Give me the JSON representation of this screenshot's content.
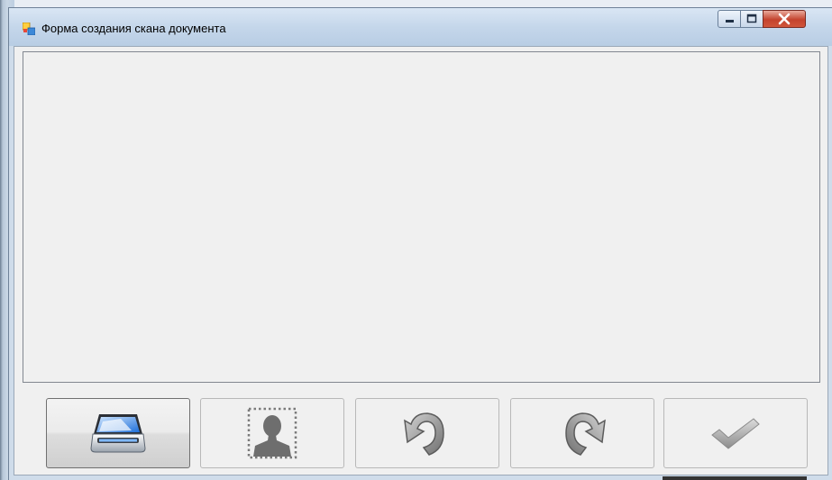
{
  "window": {
    "title": "Форма создания скана документа",
    "controls": [
      "minimize-icon",
      "maximize-icon",
      "close-icon"
    ]
  },
  "toolbar": {
    "buttons": [
      {
        "name": "scan-button",
        "icon": "scanner-icon",
        "active": true
      },
      {
        "name": "select-area-button",
        "icon": "person-selection-icon",
        "active": false
      },
      {
        "name": "rotate-left-button",
        "icon": "rotate-left-icon",
        "active": false
      },
      {
        "name": "rotate-right-button",
        "icon": "rotate-right-icon",
        "active": false
      },
      {
        "name": "confirm-button",
        "icon": "checkmark-icon",
        "active": false
      }
    ]
  },
  "colors": {
    "titlebar": "#c4d6ea",
    "client": "#f0f0f0",
    "close_button": "#c4432d"
  }
}
